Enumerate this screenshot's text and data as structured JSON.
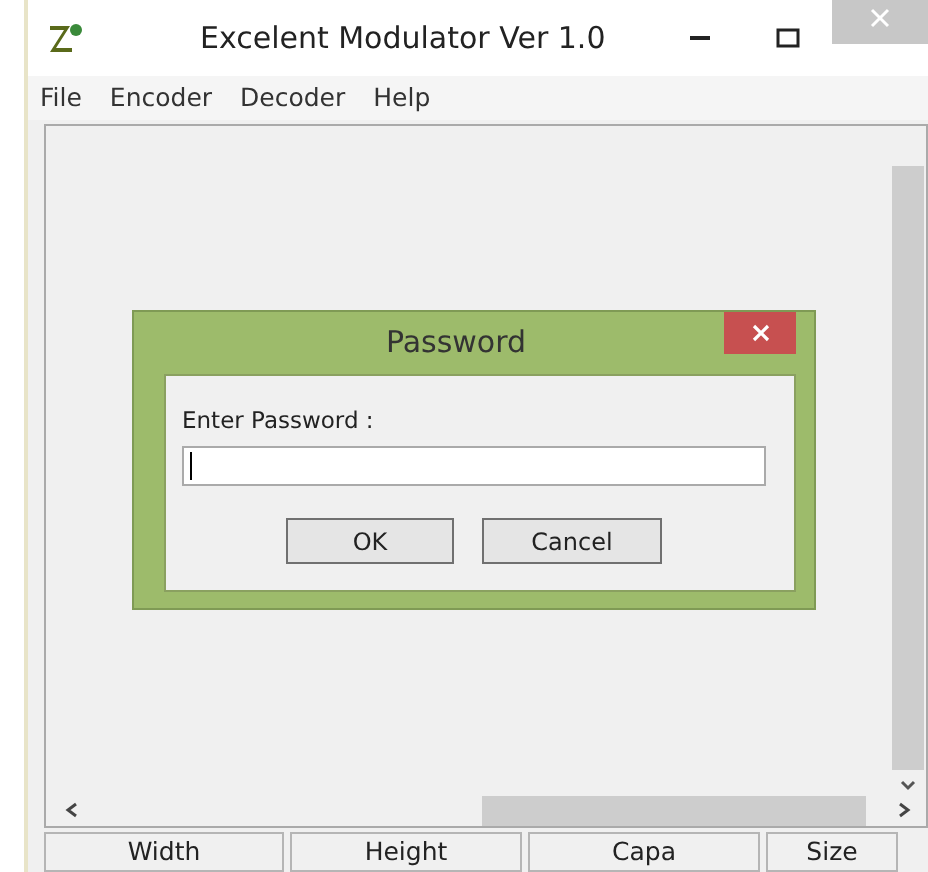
{
  "window": {
    "title": "Excelent Modulator Ver 1.0"
  },
  "menu": [
    "File",
    "Encoder",
    "Decoder",
    "Help"
  ],
  "dialog": {
    "title": "Password",
    "label": "Enter Password :",
    "buttons": [
      "OK",
      "Cancel"
    ]
  },
  "status_bar": [
    "Width",
    "Height",
    "Capa",
    "Size"
  ]
}
